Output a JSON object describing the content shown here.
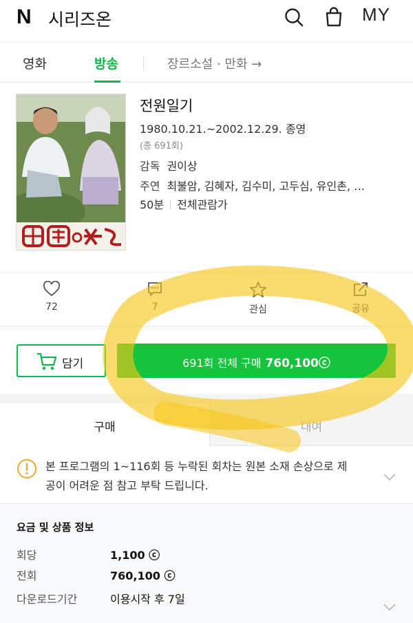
{
  "header": {
    "logo": "N",
    "title": "시리즈온",
    "my_label": "MY"
  },
  "tabs": {
    "items": [
      {
        "label": "영화"
      },
      {
        "label": "방송"
      }
    ],
    "active": "방송",
    "link_label": "장르소설 · 만화 →"
  },
  "product": {
    "title": "전원일기",
    "period": "1980.10.21.~2002.12.29. 종영",
    "episodes": "(총 691회)",
    "director_key": "감독",
    "director": "권이상",
    "cast_key": "주연",
    "cast": "최불암, 김혜자, 김수미, 고두심, 유인촌, …",
    "runtime": "50분",
    "rating": "전체관람가"
  },
  "actions": {
    "like_count": "72",
    "comment_count": "7",
    "favorite_label": "관심",
    "share_label": "공유"
  },
  "purchase": {
    "cart_label": "담기",
    "buy_label": "691회 전체 구매",
    "buy_price": "760,100ⓒ"
  },
  "buy_tabs": {
    "buy": "구매",
    "rent": "대여"
  },
  "notice": {
    "text": "본 프로그램의 1~116회 등 누락된 회차는 원본 소재 손상으로 제공이 어려운 점 참고 부탁 드립니다."
  },
  "price_info": {
    "heading": "요금 및 상품 정보",
    "rows": [
      {
        "key": "회당",
        "value": "1,100 ⓒ"
      },
      {
        "key": "전회",
        "value": "760,100 ⓒ"
      },
      {
        "key": "다운로드기간",
        "value": "이용시작 후 7일"
      }
    ]
  },
  "colors": {
    "accent": "#0bb748",
    "buy_button": "#15c43c",
    "highlight": "#f5c518",
    "notice_icon": "#f0a830"
  }
}
